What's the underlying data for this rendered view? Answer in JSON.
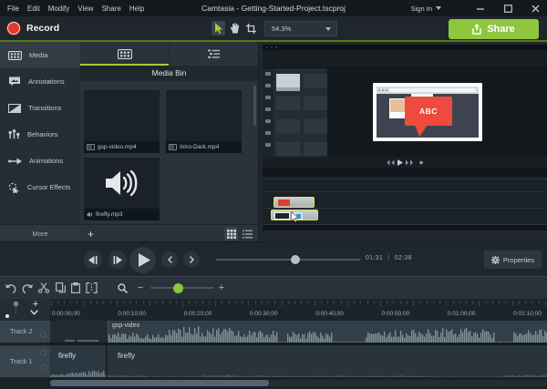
{
  "titlebar": {
    "menus": [
      "File",
      "Edit",
      "Modify",
      "View",
      "Share",
      "Help"
    ],
    "title": "Camtasia - Getting-Started-Project.tscproj",
    "sign_in": "Sign In"
  },
  "header": {
    "record_label": "Record",
    "zoom_value": "54.3%",
    "share_label": "Share",
    "accent_green": "#8dc63f",
    "record_red": "#e23a2b"
  },
  "sidebar": {
    "items": [
      {
        "label": "Media",
        "icon": "media-icon",
        "active": true
      },
      {
        "label": "Annotations",
        "icon": "annotations-icon",
        "active": false
      },
      {
        "label": "Transitions",
        "icon": "transitions-icon",
        "active": false
      },
      {
        "label": "Behaviors",
        "icon": "behaviors-icon",
        "active": false
      },
      {
        "label": "Animations",
        "icon": "animations-icon",
        "active": false
      },
      {
        "label": "Cursor Effects",
        "icon": "cursor-effects-icon",
        "active": false
      }
    ],
    "more_label": "More"
  },
  "media_bin": {
    "title": "Media Bin",
    "add_button": "+",
    "items": [
      {
        "name": "gsp-video.mp4",
        "type": "video"
      },
      {
        "name": "Intro-Dark.mp4",
        "type": "video"
      },
      {
        "name": "firefly.mp3",
        "type": "audio"
      }
    ]
  },
  "preview": {
    "callout_text": "ABC",
    "callout_color": "#ee4b3e"
  },
  "playback": {
    "current_time": "01:31",
    "separator": "/",
    "total_time": "02:38",
    "properties_label": "Properties"
  },
  "timeline": {
    "add_track_button": "+",
    "zoom_out_button": "−",
    "zoom_in_button": "+",
    "ruler_labels": [
      "0:00:00;00",
      "0:00:10;00",
      "0:00:20;00",
      "0:00:30;00",
      "0:00:40;00",
      "0:00:50;00",
      "0:01:00;00",
      "0:01:10;00"
    ],
    "tracks": [
      {
        "name": "Track 2",
        "clips": [
          "gsp-video"
        ]
      },
      {
        "name": "Track 1",
        "clips": [
          "firefly",
          "firefly"
        ]
      }
    ]
  }
}
